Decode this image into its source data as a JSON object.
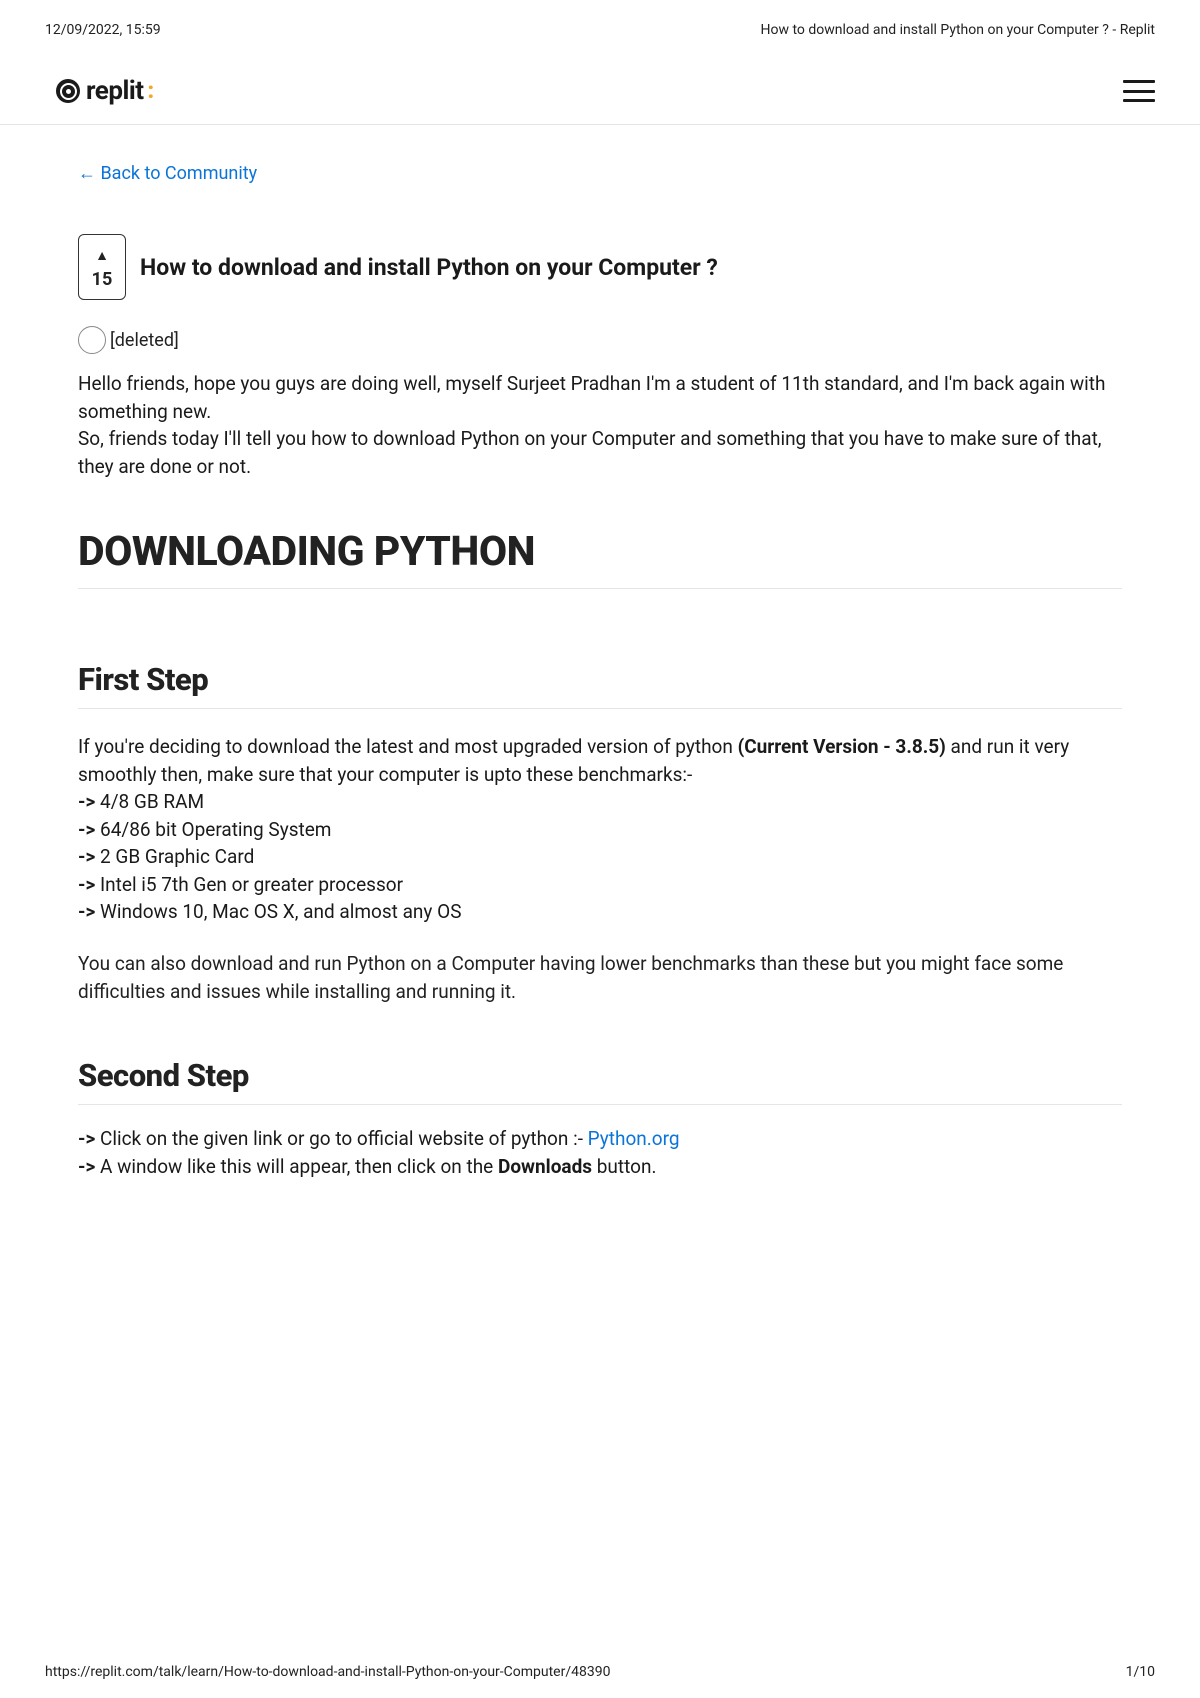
{
  "print": {
    "timestamp": "12/09/2022, 15:59",
    "doc_title": "How to download and install Python on your Computer ? - Replit",
    "url": "https://replit.com/talk/learn/How-to-download-and-install-Python-on-your-Computer/48390",
    "page_num": "1/10"
  },
  "brand": {
    "name": "replit",
    "prompt": ":"
  },
  "nav": {
    "back_link": "← Back to Community"
  },
  "post": {
    "vote_count": "15",
    "title": "How to download and install Python on your Computer ?",
    "author": "[deleted]",
    "intro_line1": "Hello friends, hope you guys are doing well, myself Surjeet Pradhan I'm a student of 11th standard, and I'm back again with something new.",
    "intro_line2": "So, friends today I'll tell you how to download Python on your Computer and something that you have to make sure of that, they are done or not."
  },
  "headings": {
    "main": "DOWNLOADING PYTHON",
    "step1": "First Step",
    "step2": "Second Step"
  },
  "step1": {
    "lead_pre": "If you're deciding to download the latest and most upgraded version of python ",
    "lead_bold": "(Current Version - 3.8.5)",
    "lead_post": " and run it very smoothly then, make sure that your computer is upto these benchmarks:-",
    "items": [
      "4/8 GB RAM",
      "64/86 bit Operating System",
      "2 GB Graphic Card",
      "Intel i5 7th Gen or greater processor",
      "Windows 10, Mac OS X, and almost any OS"
    ],
    "note": "You can also download and run Python on a Computer having lower benchmarks than these but you might face some difficulties and issues while installing and running it."
  },
  "step2": {
    "arrow": "->",
    "item1_pre": " Click on the given link or go to official website of python :- ",
    "item1_link": "Python.org",
    "item2_pre": " A window like this will appear, then click on the ",
    "item2_bold": "Downloads",
    "item2_post": " button."
  }
}
